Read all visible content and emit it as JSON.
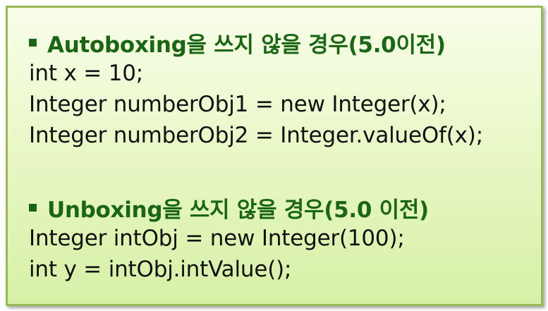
{
  "sections": [
    {
      "heading": "Autoboxing을 쓰지 않을 경우(5.0이전)",
      "lines": [
        "int x = 10;",
        "Integer numberObj1 = new Integer(x);",
        "Integer numberObj2 = Integer.valueOf(x);"
      ]
    },
    {
      "heading": "Unboxing을 쓰지 않을 경우(5.0 이전)",
      "lines": [
        "Integer intObj = new Integer(100);",
        "int y = intObj.intValue();"
      ]
    }
  ],
  "colors": {
    "heading": "#1b6614",
    "border": "#98b954",
    "background_top": "#f8fde9",
    "background_bottom": "#d7f0a6"
  }
}
